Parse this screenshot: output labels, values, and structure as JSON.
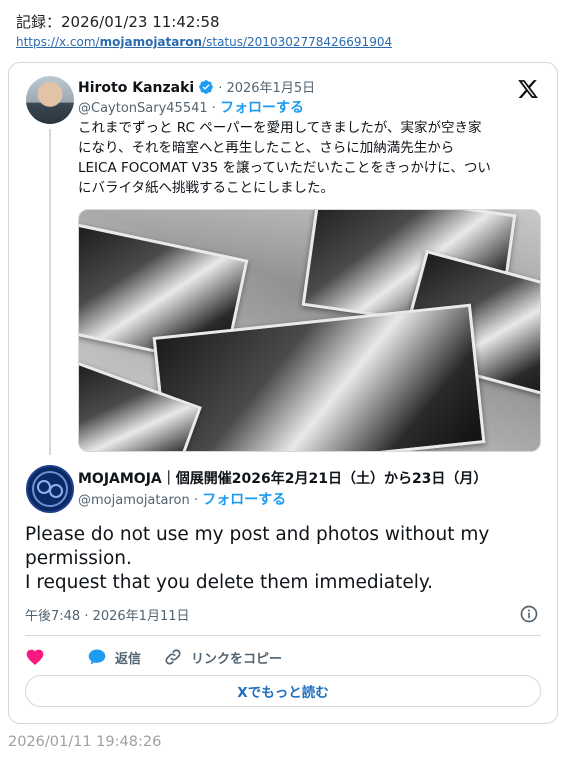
{
  "record": {
    "label": "記録：2026/01/23 11:42:58",
    "url_prefix": "https://x.com/",
    "url_user": "mojamojataron",
    "url_suffix": "/status/2010302778426691904"
  },
  "tweet": {
    "author_name": "Hiroto Kanzaki",
    "date": "· 2026年1月5日",
    "handle": "@CaytonSary45541 ·",
    "follow_label": "フォローする",
    "text_lines": [
      "これまでずっと RC ペーパーを愛用してきましたが、実家が空き家",
      "になり、それを暗室へと再生したこと、さらに加納満先生から",
      "LEICA FOCOMAT V35 を譲っていただいたことをきっかけに、つい",
      "にバライタ紙へ挑戦することにしました。"
    ]
  },
  "reply": {
    "author_name": "MOJAMOJA｜個展開催2026年2月21日（土）から23日（月）",
    "handle": "@mojamojataron ·",
    "follow_label": "フォローする",
    "text_lines": [
      "Please do not use my post and photos without my",
      "permission.",
      "I request that you delete them immediately."
    ],
    "timestamp": "午後7:48 · 2026年1月11日"
  },
  "actions": {
    "reply_label": "返信",
    "copy_link_label": "リンクをコピー",
    "read_more_label": "Xでもっと読む"
  },
  "footer": {
    "timestamp": "2026/01/11 19:48:26"
  },
  "colors": {
    "accent": "#1d9bf0",
    "like": "#f91880",
    "border": "#cfd9de",
    "muted": "#536471"
  },
  "icons": [
    "x-logo-icon",
    "verified-badge-icon",
    "heart-icon",
    "reply-bubble-icon",
    "link-icon",
    "info-icon"
  ]
}
